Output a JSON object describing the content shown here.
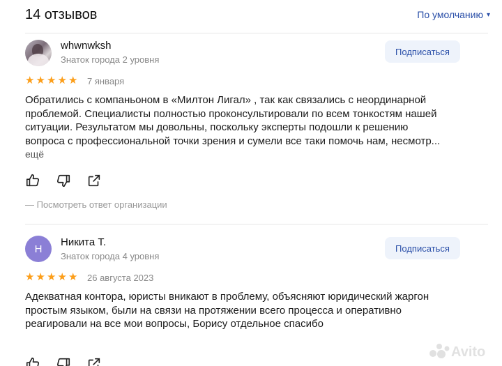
{
  "header": {
    "review_count": "14 отзывов",
    "sort_label": "По умолчанию",
    "sort_caret": "▾"
  },
  "reviews": [
    {
      "author": "whwnwksh",
      "level": "Знаток города 2 уровня",
      "subscribe_label": "Подписаться",
      "rating": 5,
      "stars": "★★★★★",
      "date": "7 января",
      "text_lines": [
        "Обратились с компаньоном в «Милтон Лигал» , так как связались с неординарной",
        "проблемой. Специалисты полностью проконсультировали по всем тонкостям нашей",
        "ситуации. Результатом мы довольны, поскольку эксперты подошли к решению",
        "вопроса с профессиональной точки зрения и сумели все таки помочь нам, несмотр..."
      ],
      "more_label": "ещё",
      "org_reply_label": "— Посмотреть ответ организации"
    },
    {
      "author": "Никита Т.",
      "avatar_letter": "Н",
      "level": "Знаток города 4 уровня",
      "subscribe_label": "Подписаться",
      "rating": 5,
      "stars": "★★★★★",
      "date": "26 августа 2023",
      "text_lines": [
        "Адекватная контора, юристы вникают в проблему, объясняют юридический жаргон",
        "простым языком, были на связи на протяжении всего процесса и оперативно",
        "реагировали на все мои вопросы, Борису отдельное спасибо"
      ]
    }
  ],
  "colors": {
    "star": "#fc9e1a",
    "accent": "#2a4fa8",
    "subscribe_bg": "#eef3fb",
    "avatar_letter_bg": "#8b7fd6"
  },
  "icons": {
    "like": "thumbs-up-icon",
    "dislike": "thumbs-down-icon",
    "share": "share-icon"
  },
  "watermark": {
    "label": "Avito"
  }
}
